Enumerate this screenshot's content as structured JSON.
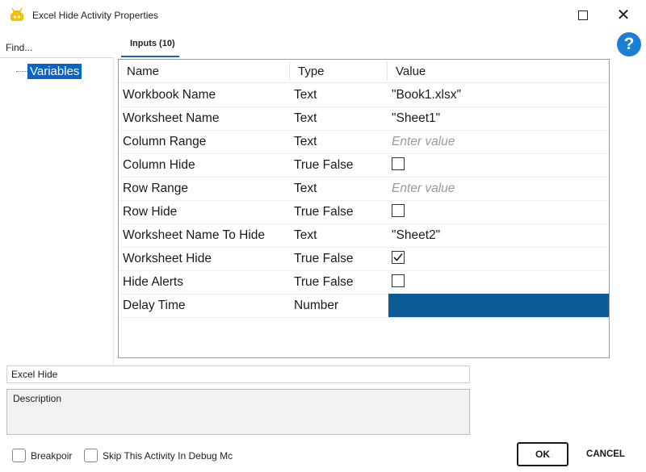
{
  "window": {
    "title": "Excel Hide Activity Properties"
  },
  "left_pane": {
    "find_label": "Find...",
    "tree_items": [
      "Variables"
    ]
  },
  "tab": {
    "label": "Inputs (10)"
  },
  "help": {
    "glyph": "?"
  },
  "grid": {
    "columns": [
      "Name",
      "Type",
      "Value"
    ],
    "rows": [
      {
        "name": "Workbook Name",
        "type": "Text",
        "value": "\"Book1.xlsx\""
      },
      {
        "name": "Worksheet Name",
        "type": "Text",
        "value": "\"Sheet1\""
      },
      {
        "name": "Column Range",
        "type": "Text",
        "placeholder": "Enter value"
      },
      {
        "name": "Column Hide",
        "type": "True False",
        "checked": false
      },
      {
        "name": "Row Range",
        "type": "Text",
        "placeholder": "Enter value"
      },
      {
        "name": "Row Hide",
        "type": "True False",
        "checked": false
      },
      {
        "name": "Worksheet Name To Hide",
        "type": "Text",
        "value": "\"Sheet2\""
      },
      {
        "name": "Worksheet Hide",
        "type": "True False",
        "checked": true
      },
      {
        "name": "Hide Alerts",
        "type": "True False",
        "checked": false
      },
      {
        "name": "Delay Time",
        "type": "Number",
        "selected": true
      }
    ]
  },
  "activity_name": "Excel Hide",
  "description_label": "Description",
  "options": {
    "breakpoint_label": "Breakpoir",
    "skip_label": "Skip This Activity In Debug Mc"
  },
  "buttons": {
    "ok": "OK",
    "cancel": "CANCEL"
  },
  "colors": {
    "selection": "#0a64c8",
    "selected_cell": "#0a5a96",
    "help": "#1b7fd6"
  }
}
